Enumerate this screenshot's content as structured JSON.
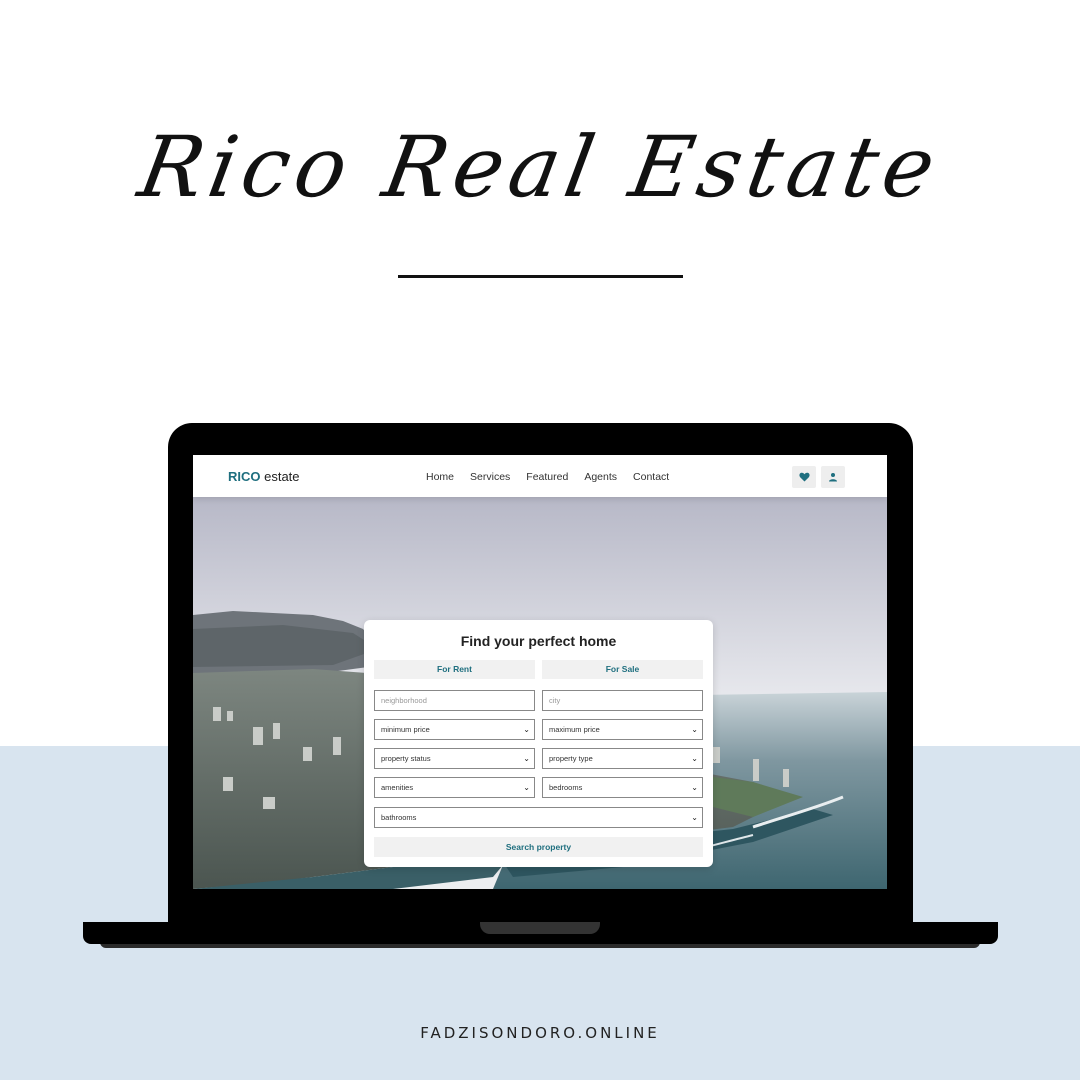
{
  "page": {
    "title": "Rico Real Estate",
    "footer": "FADZISONDORO.ONLINE"
  },
  "site": {
    "logo_accent": "RICO",
    "logo_rest": " estate",
    "accent_color": "#1f6f7f",
    "nav": [
      "Home",
      "Services",
      "Featured",
      "Agents",
      "Contact"
    ],
    "icons": [
      "heart-icon",
      "user-icon"
    ]
  },
  "search": {
    "heading": "Find your perfect home",
    "tabs": [
      "For Rent",
      "For Sale"
    ],
    "neighborhood_placeholder": "neighborhood",
    "city_placeholder": "city",
    "selects": {
      "min_price": "minimum price",
      "max_price": "maximum price",
      "status": "property status",
      "type": "property type",
      "amenities": "amenities",
      "bedrooms": "bedrooms",
      "bathrooms": "bathrooms"
    },
    "button": "Search property"
  }
}
